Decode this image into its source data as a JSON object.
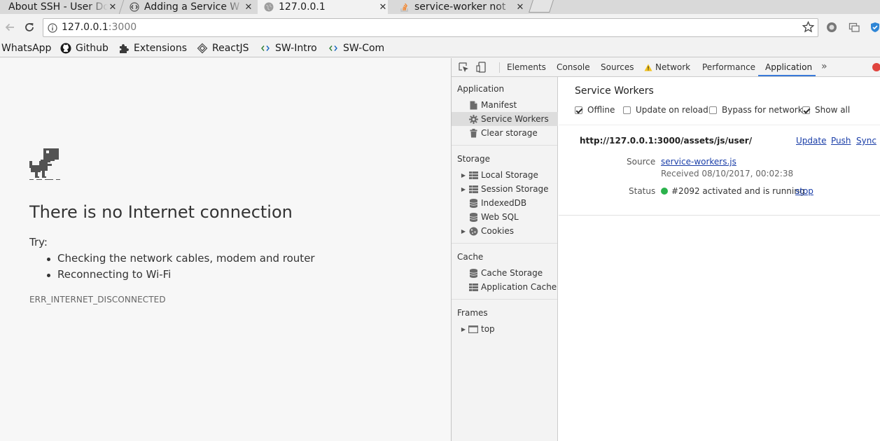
{
  "browser": {
    "tabs": [
      {
        "title": "About SSH - User Do",
        "icon": "blank-icon",
        "active": false
      },
      {
        "title": "Adding a Service W",
        "icon": "code-icon",
        "active": false
      },
      {
        "title": "127.0.0.1",
        "icon": "globe-icon",
        "active": true
      },
      {
        "title": "service-worker not",
        "icon": "stackoverflow-icon",
        "active": false
      }
    ],
    "close_glyph": "✕",
    "address": {
      "host": "127.0.0.1",
      "port": ":3000"
    },
    "bookmarks": [
      {
        "label": "WhatsApp",
        "icon": "none"
      },
      {
        "label": "Github",
        "icon": "github-icon"
      },
      {
        "label": "Extensions",
        "icon": "puzzle-icon"
      },
      {
        "label": "ReactJS",
        "icon": "react-icon"
      },
      {
        "label": "SW-Intro",
        "icon": "code-icon"
      },
      {
        "label": "SW-Com",
        "icon": "code-icon"
      }
    ]
  },
  "page": {
    "title": "There is no Internet connection",
    "try_label": "Try:",
    "suggestions": [
      "Checking the network cables, modem and router",
      "Reconnecting to Wi-Fi"
    ],
    "error_code": "ERR_INTERNET_DISCONNECTED"
  },
  "devtools": {
    "tabs": [
      "Elements",
      "Console",
      "Sources",
      "Network",
      "Performance",
      "Application"
    ],
    "active_tab": "Application",
    "more_glyph": "»",
    "sidebar": {
      "sections": [
        {
          "title": "Application",
          "items": [
            "Manifest",
            "Service Workers",
            "Clear storage"
          ]
        },
        {
          "title": "Storage",
          "items": [
            "Local Storage",
            "Session Storage",
            "IndexedDB",
            "Web SQL",
            "Cookies"
          ]
        },
        {
          "title": "Cache",
          "items": [
            "Cache Storage",
            "Application Cache"
          ]
        },
        {
          "title": "Frames",
          "items": [
            "top"
          ]
        }
      ],
      "selected": "Service Workers"
    },
    "service_workers": {
      "title": "Service Workers",
      "options": [
        {
          "label": "Offline",
          "checked": true
        },
        {
          "label": "Update on reload",
          "checked": false
        },
        {
          "label": "Bypass for network",
          "checked": false
        },
        {
          "label": "Show all",
          "checked": true
        }
      ],
      "scope": "http://127.0.0.1:3000/assets/js/user/",
      "actions": [
        "Update",
        "Push",
        "Sync"
      ],
      "source_label": "Source",
      "source_file": "service-workers.js",
      "received": "Received 08/10/2017, 00:02:38",
      "status_label": "Status",
      "status_text": "#2092 activated and is running",
      "status_action": "stop",
      "status_color": "#2bb24c"
    }
  }
}
